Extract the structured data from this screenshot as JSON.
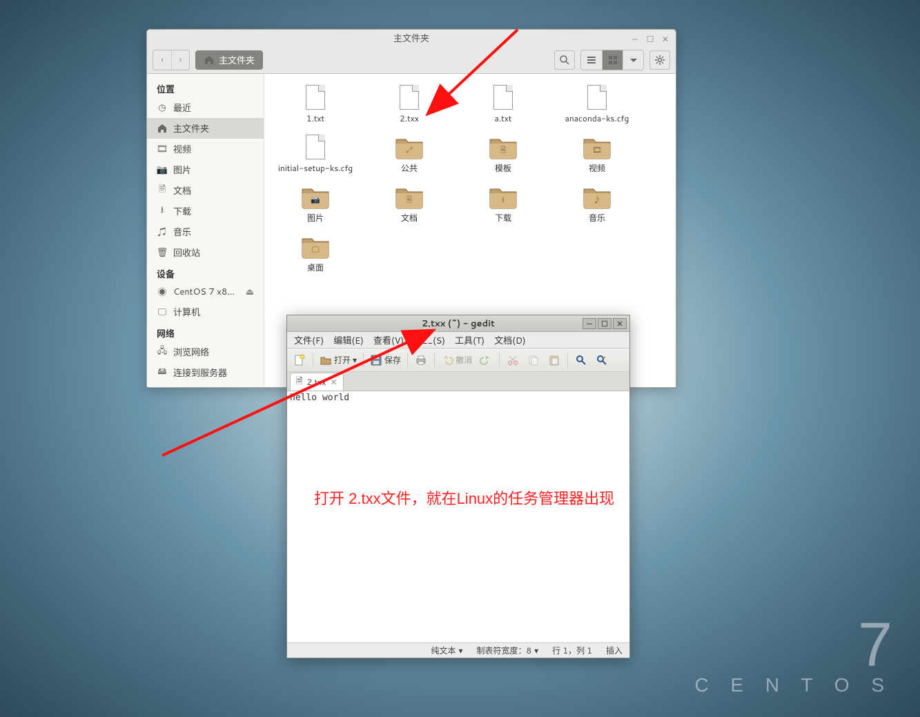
{
  "desktop": {
    "brand_number": "7",
    "brand_text": "C E N T O S"
  },
  "file_manager": {
    "title": "主文件夹",
    "path_button": "主文件夹",
    "sidebar": {
      "places_header": "位置",
      "devices_header": "设备",
      "network_header": "网络",
      "items": {
        "recent": "最近",
        "home": "主文件夹",
        "videos": "视频",
        "pictures": "图片",
        "documents": "文档",
        "downloads": "下载",
        "music": "音乐",
        "trash": "回收站",
        "cd": "CentOS 7 x8…",
        "computer": "计算机",
        "browse": "浏览网络",
        "connect": "连接到服务器"
      }
    },
    "files": [
      {
        "name": "1.txt",
        "type": "file"
      },
      {
        "name": "2.txx",
        "type": "file"
      },
      {
        "name": "a.txt",
        "type": "file"
      },
      {
        "name": "anaconda-ks.cfg",
        "type": "file"
      },
      {
        "name": "initial-setup-ks.cfg",
        "type": "file"
      },
      {
        "name": "公共",
        "type": "folder",
        "badge": "share"
      },
      {
        "name": "模板",
        "type": "folder",
        "badge": "template"
      },
      {
        "name": "视频",
        "type": "folder",
        "badge": "video"
      },
      {
        "name": "图片",
        "type": "folder",
        "badge": "photo"
      },
      {
        "name": "文档",
        "type": "folder",
        "badge": "doc"
      },
      {
        "name": "下载",
        "type": "folder",
        "badge": "download"
      },
      {
        "name": "音乐",
        "type": "folder",
        "badge": "music"
      },
      {
        "name": "桌面",
        "type": "folder",
        "badge": "desktop"
      }
    ]
  },
  "gedit": {
    "title": "2.txx (~) - gedit",
    "menu": {
      "file": "文件(F)",
      "edit": "编辑(E)",
      "view": "查看(V)",
      "search": "搜__(S)",
      "tools": "工具(T)",
      "docs": "文档(D)"
    },
    "toolbar": {
      "open": "打开",
      "save": "保存",
      "undo": "撤消"
    },
    "tab_name": "2.txx",
    "editor_content": "hello world",
    "statusbar": {
      "plaintext": "纯文本",
      "tabwidth": "制表符宽度：8",
      "position": "行 1，列 1",
      "insert": "插入"
    }
  },
  "annotation": {
    "text": "打开 2.txx文件，就在Linux的任务管理器出现"
  }
}
